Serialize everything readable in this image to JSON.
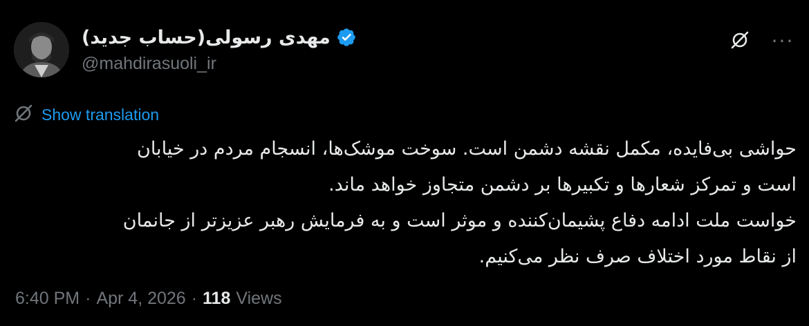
{
  "author": {
    "display_name": "مهدی رسولی(حساب جدید)",
    "handle": "@mahdirasuoli_ir",
    "verified": true
  },
  "icons": {
    "verified": "verified-badge-icon",
    "grok": "grok-icon",
    "more": "more-options-icon",
    "translate": "translate-icon"
  },
  "colors": {
    "background": "#000000",
    "text": "#e7e9ea",
    "secondary": "#71767b",
    "accent": "#1d9bf0"
  },
  "translate": {
    "label": "Show translation"
  },
  "more_label": "···",
  "tweet": {
    "lines": [
      "حواشی بی‌فایده، مکمل نقشه دشمن است. سوخت موشک‌ها، انسجام مردم در خیابان",
      "است و تمرکز شعارها و تکبیرها بر دشمن متجاوز خواهد ماند.",
      "خواست ملت ادامه دفاع پشیمان‌کننده و موثر است و به فرمایش رهبر عزیزتر از جانمان",
      "از نقاط مورد اختلاف صرف نظر می‌کنیم."
    ]
  },
  "meta": {
    "time": "6:40 PM",
    "separator": "·",
    "date": "Apr 4, 2026",
    "views_count": "118",
    "views_label": "Views"
  }
}
